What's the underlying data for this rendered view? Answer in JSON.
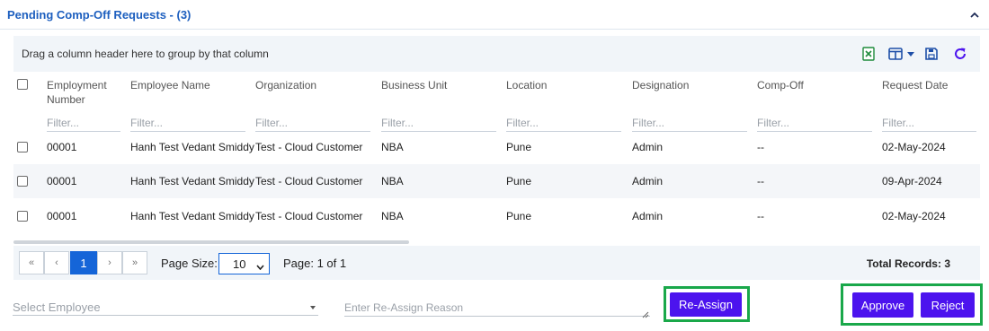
{
  "panel": {
    "title": "Pending Comp-Off Requests - (3)"
  },
  "grid": {
    "group_hint": "Drag a column header here to group by that column",
    "columns": [
      "Employment Number",
      "Employee Name",
      "Organization",
      "Business Unit",
      "Location",
      "Designation",
      "Comp-Off",
      "Request Date"
    ],
    "filter_placeholder": "Filter...",
    "rows": [
      [
        "00001",
        "Hanh Test Vedant Smiddy",
        "Test - Cloud Customer",
        "NBA",
        "Pune",
        "Admin",
        "--",
        "02-May-2024"
      ],
      [
        "00001",
        "Hanh Test Vedant Smiddy",
        "Test - Cloud Customer",
        "NBA",
        "Pune",
        "Admin",
        "--",
        "09-Apr-2024"
      ],
      [
        "00001",
        "Hanh Test Vedant Smiddy",
        "Test - Cloud Customer",
        "NBA",
        "Pune",
        "Admin",
        "--",
        "02-May-2024"
      ]
    ],
    "icons": {
      "excel": "excel-export-icon",
      "columns": "columns-icon",
      "save": "save-icon",
      "refresh": "refresh-icon"
    }
  },
  "pager": {
    "first": "«",
    "prev": "‹",
    "current": "1",
    "next": "›",
    "last": "»",
    "page_size_label": "Page Size:",
    "page_size_value": "10",
    "page_info": "Page: 1 of 1",
    "total": "Total Records: 3"
  },
  "actions": {
    "employee_placeholder": "Select Employee",
    "reason_placeholder": "Enter Re-Assign Reason",
    "reassign": "Re-Assign",
    "approve": "Approve",
    "reject": "Reject"
  },
  "colors": {
    "title_blue": "#1d5fbf",
    "accent_purple": "#4c13ee",
    "highlight_green": "#1aa84a",
    "pager_blue": "#1565d8"
  }
}
